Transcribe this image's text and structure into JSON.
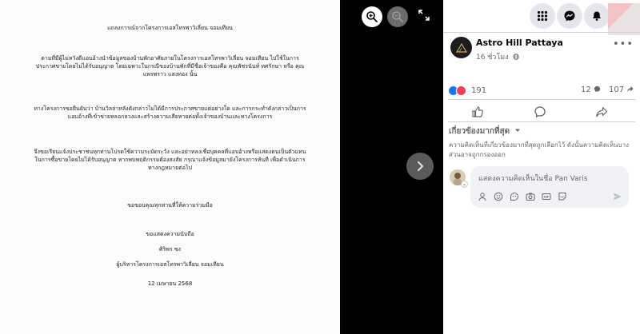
{
  "document": {
    "title": "แถลงการณ์จากโครงการเอสโทรพาวิเลี่ยน จอมเทียน",
    "para1": "ตามที่มีผู้ไม่หวังดีแอบอ้างนำข้อมูลของบ้านพักอาศัยภายในโครงการเอสโทรพาวิเลี่ยน จอมเทียน ไปใช้ในการประกาศขายโดยไม่ได้รับอนุญาต โดยเฉพาะในกรณีของบ้านพักที่มีชื่อเจ้าของคือ คุณพัชรนันท์ ทศรักษา หรือ คุณแพรพราว แสงทอง นั้น",
    "para2": "ทางโครงการขอยืนยันว่า บ้านวิลล่าหลังดังกล่าวไม่ได้มีการประกาศขายแต่อย่างใด และการกระทำดังกล่าวเป็นการแอบอ้างที่เข้าข่ายหลอกลวงและสร้างความเสียหายต่อทั้งเจ้าของบ้านและทางโครงการ",
    "para3": "จึงขอเรียนแจ้งประชาชนทุกท่านโปรดใช้ความระมัดระวัง และอย่าหลงเชื่อบุคคลที่แอบอ้างหรือแสดงตนเป็นตัวแทนในการซื้อขายโดยไม่ได้รับอนุญาต หากพบพฤติกรรมต้องสงสัย กรุณาแจ้งข้อมูลมายังโครงการทันที เพื่อดำเนินการทางกฎหมายต่อไป",
    "thanks": "ขอขอบคุณทุกท่านที่ให้ความร่วมมือ",
    "regards": "ขอแสดงความนับถือ",
    "signer": "ศิริพร ซง",
    "position": "ผู้บริหารโครงการเอสโทรพาวิเลี่ยน จอมเทียน",
    "date": "12 เมษายน 2568"
  },
  "viewer": {
    "zoom_in_icon": "zoom-in-icon",
    "zoom_out_icon": "zoom-out-icon",
    "expand_icon": "expand-icon",
    "next_icon": "chevron-right-icon"
  },
  "post": {
    "page_name": "Astro Hill Pattaya",
    "time": "16 ชั่วโมง",
    "reaction_count": "191",
    "comment_count": "12",
    "share_count": "107",
    "sort_label": "เกี่ยวข้องมากที่สุด",
    "sort_note": "ความคิดเห็นที่เกี่ยวข้องมากที่สุดถูกเลือกไว้ ดังนั้นความคิดเห็นบางส่วนอาจถูกกรองออก",
    "comment_placeholder": "แสดงความคิดเห็นในชื่อ Pan Varis"
  },
  "colors": {
    "accent": "#1877f2",
    "love": "#f33e58",
    "muted": "#65676b"
  }
}
